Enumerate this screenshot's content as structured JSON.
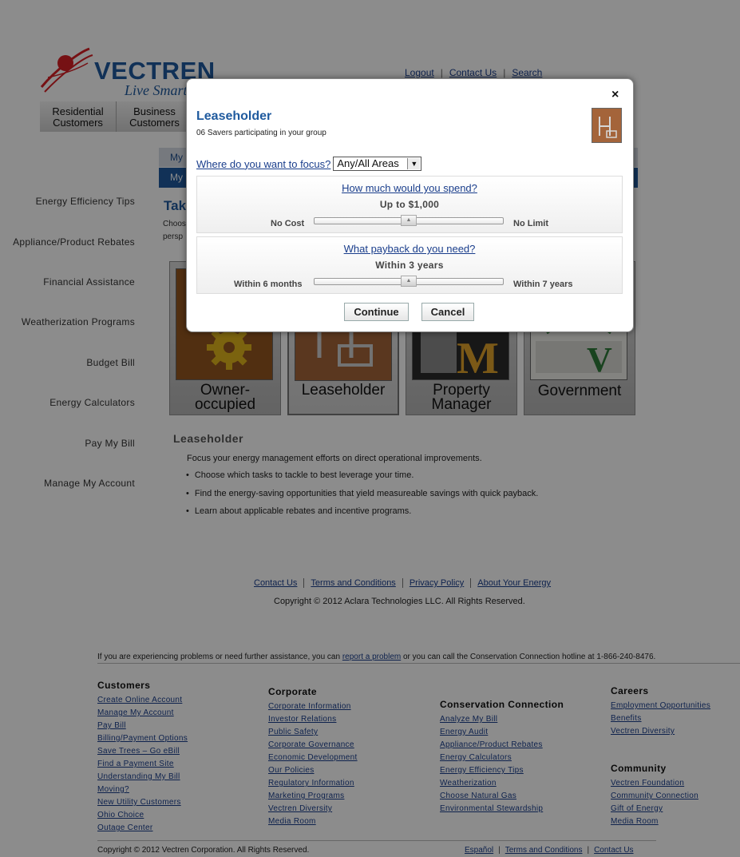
{
  "header": {
    "logo_word": "VECTREN",
    "logo_tag": "Live Smart",
    "top_links": [
      "Logout",
      "Contact Us",
      "Search"
    ],
    "nav_tabs": [
      {
        "line1": "Residential",
        "line2": "Customers"
      },
      {
        "line1": "Business",
        "line2": "Customers"
      }
    ],
    "subnav1": "My",
    "subnav2": "My",
    "page_heading": "Tak",
    "intro_line1": "Choos",
    "intro_line2": "persp"
  },
  "sidebar": {
    "items": [
      "Energy Efficiency Tips",
      "Appliance/Product Rebates",
      "Financial Assistance",
      "Weatherization Programs",
      "Budget Bill",
      "Energy Calculators",
      "Pay My Bill",
      "Manage My Account"
    ]
  },
  "cards": [
    {
      "label": "Owner-occupied",
      "selected": false
    },
    {
      "label": "Leaseholder",
      "selected": true
    },
    {
      "label": "Property Manager",
      "selected": false
    },
    {
      "label": "Government",
      "selected": false
    }
  ],
  "content": {
    "title": "Leaseholder",
    "intro": "Focus your energy management efforts on direct operational improvements.",
    "bullets": [
      "Choose which tasks to tackle to best leverage your time.",
      "Find the energy-saving opportunities that yield measureable savings with quick payback.",
      "Learn about applicable rebates and incentive programs."
    ]
  },
  "footer_links": [
    "Contact Us",
    "Terms and Conditions",
    "Privacy Policy",
    "About Your Energy"
  ],
  "copyright_aclara": "Copyright © 2012 Aclara Technologies LLC. All Rights Reserved.",
  "problem": {
    "before": "If you are experiencing problems or need further assistance, you can ",
    "link": "report a problem",
    "after": " or you can call the Conservation Connection hotline at 1-866-240-8476."
  },
  "footer_columns": {
    "customers": {
      "heading": "Customers",
      "items": [
        "Create Online Account",
        "Manage My Account",
        "Pay Bill",
        "Billing/Payment Options",
        "Save Trees – Go eBill",
        "Find a Payment Site",
        "Understanding My Bill",
        "Moving?",
        "New Utility Customers",
        "Ohio Choice",
        "Outage Center"
      ]
    },
    "corporate": {
      "heading": "Corporate",
      "items": [
        "Corporate Information",
        "Investor Relations",
        "Public Safety",
        "Corporate Governance",
        "Economic Development",
        "Our Policies",
        "Regulatory Information",
        "Marketing Programs",
        "Vectren Diversity",
        "Media Room"
      ]
    },
    "conservation": {
      "heading": "Conservation Connection",
      "items": [
        "Analyze My Bill",
        "Energy Audit",
        "Appliance/Product Rebates",
        "Energy Calculators",
        "Energy Efficiency Tips",
        "Weatherization",
        "Choose Natural Gas",
        "Environmental Stewardship"
      ]
    },
    "careers": {
      "heading": "Careers",
      "items": [
        "Employment Opportunities",
        "Benefits",
        "Vectren Diversity"
      ]
    },
    "community": {
      "heading": "Community",
      "items": [
        "Vectren Foundation",
        "Community Connection",
        "Gift of Energy",
        "Media Room"
      ]
    }
  },
  "copyright_vectren": "Copyright © 2012 Vectren Corporation. All Rights Reserved.",
  "legal_links": [
    "Español",
    "Terms and Conditions",
    "Contact Us"
  ],
  "modal": {
    "close_glyph": "×",
    "title": "Leaseholder",
    "subtitle": "06 Savers participating in your group",
    "focus_question": "Where do you want to focus?",
    "focus_value": "Any/All Areas",
    "spend": {
      "question": "How much would you spend?",
      "value": "Up to $1,000",
      "min_label": "No Cost",
      "max_label": "No Limit",
      "level": 0.5
    },
    "payback": {
      "question": "What payback do you need?",
      "value": "Within 3 years",
      "min_label": "Within 6 months",
      "max_label": "Within 7 years",
      "level": 0.5
    },
    "continue_label": "Continue",
    "cancel_label": "Cancel"
  },
  "colors": {
    "brand_blue": "#1f5a9e",
    "link_blue": "#1a3e8c",
    "logo_red": "#d81f26"
  }
}
